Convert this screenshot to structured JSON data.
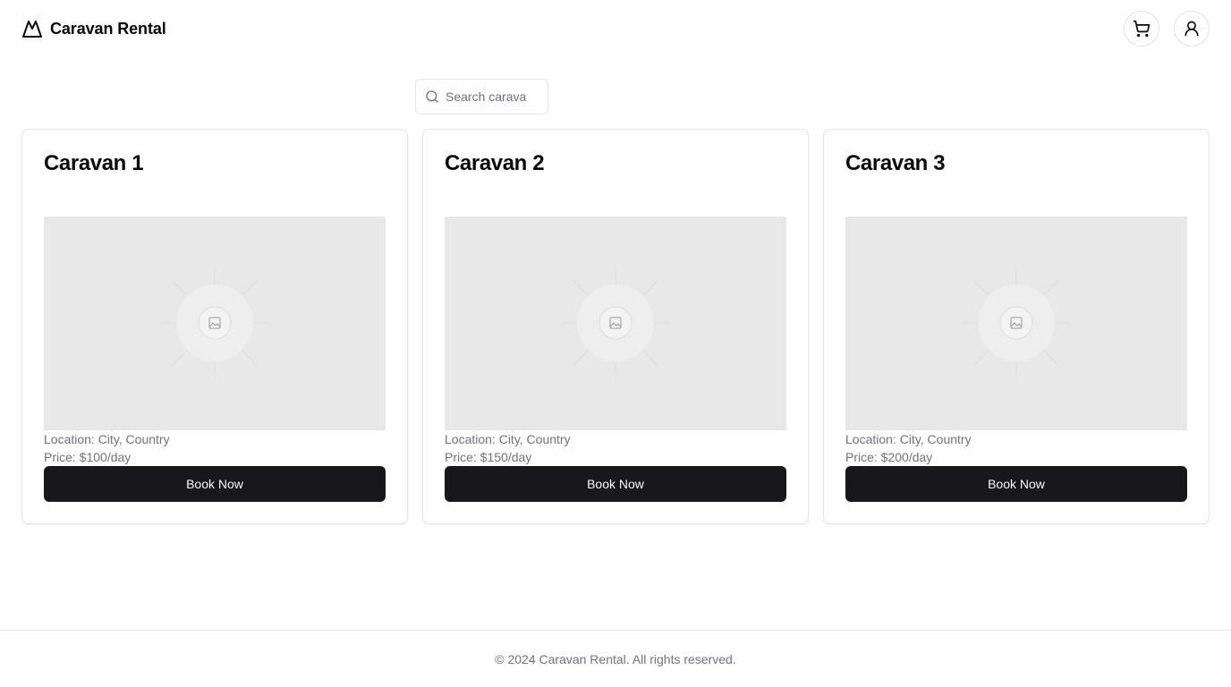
{
  "brand": {
    "name": "Caravan Rental",
    "logo_icon": "mountain-icon"
  },
  "header": {
    "cart_icon": "shopping-cart-icon",
    "user_icon": "user-icon"
  },
  "search": {
    "placeholder": "Search caravans...",
    "value": ""
  },
  "cards": [
    {
      "title": "Caravan 1",
      "location": "Location: City, Country",
      "price": "Price: $100/day",
      "button": "Book Now"
    },
    {
      "title": "Caravan 2",
      "location": "Location: City, Country",
      "price": "Price: $150/day",
      "button": "Book Now"
    },
    {
      "title": "Caravan 3",
      "location": "Location: City, Country",
      "price": "Price: $200/day",
      "button": "Book Now"
    }
  ],
  "footer": {
    "text": "© 2024 Caravan Rental. All rights reserved."
  },
  "colors": {
    "primary_button": "#18181b",
    "border": "#e4e4e7",
    "muted_text": "#71717a",
    "placeholder_bg": "#e8e8e8"
  }
}
